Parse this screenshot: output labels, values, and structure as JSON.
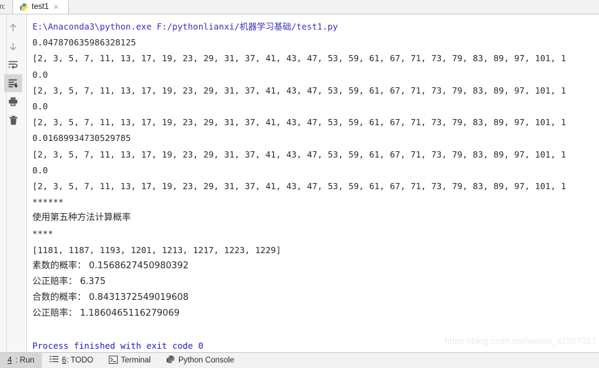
{
  "toolwindow": {
    "clipped_label": "n:"
  },
  "tabbar": {
    "tab_title": "test1",
    "tab_icon": "python-file-icon",
    "close_label": "×"
  },
  "gutter": {
    "buttons": [
      {
        "name": "up-arrow-icon",
        "title": "Up the Stack Trace",
        "active": false
      },
      {
        "name": "down-arrow-icon",
        "title": "Down the Stack Trace",
        "active": false
      },
      {
        "name": "soft-wrap-icon",
        "title": "Soft-Wrap",
        "active": false
      },
      {
        "name": "scroll-to-end-icon",
        "title": "Scroll to End",
        "active": true
      },
      {
        "name": "print-icon",
        "title": "Print",
        "active": false
      },
      {
        "name": "trash-icon",
        "title": "Clear All",
        "active": false
      }
    ]
  },
  "console": {
    "command": "E:\\Anaconda3\\python.exe F:/pythonlianxi/机器学习基础/test1.py",
    "prime_list": "[2, 3, 5, 7, 11, 13, 17, 19, 23, 29, 31, 37, 41, 43, 47, 53, 59, 61, 67, 71, 73, 79, 83, 89, 97, 101, 1",
    "lines": [
      {
        "type": "cmd",
        "text": "E:\\Anaconda3\\python.exe F:/pythonlianxi/机器学习基础/test1.py"
      },
      {
        "type": "out",
        "text": "0.047870635986328125"
      },
      {
        "type": "out",
        "text": "[2, 3, 5, 7, 11, 13, 17, 19, 23, 29, 31, 37, 41, 43, 47, 53, 59, 61, 67, 71, 73, 79, 83, 89, 97, 101, 1"
      },
      {
        "type": "out",
        "text": "0.0"
      },
      {
        "type": "out",
        "text": "[2, 3, 5, 7, 11, 13, 17, 19, 23, 29, 31, 37, 41, 43, 47, 53, 59, 61, 67, 71, 73, 79, 83, 89, 97, 101, 1"
      },
      {
        "type": "out",
        "text": "0.0"
      },
      {
        "type": "out",
        "text": "[2, 3, 5, 7, 11, 13, 17, 19, 23, 29, 31, 37, 41, 43, 47, 53, 59, 61, 67, 71, 73, 79, 83, 89, 97, 101, 1"
      },
      {
        "type": "out",
        "text": "0.01689934730529785"
      },
      {
        "type": "out",
        "text": "[2, 3, 5, 7, 11, 13, 17, 19, 23, 29, 31, 37, 41, 43, 47, 53, 59, 61, 67, 71, 73, 79, 83, 89, 97, 101, 1"
      },
      {
        "type": "out",
        "text": "0.0"
      },
      {
        "type": "out",
        "text": "[2, 3, 5, 7, 11, 13, 17, 19, 23, 29, 31, 37, 41, 43, 47, 53, 59, 61, 67, 71, 73, 79, 83, 89, 97, 101, 1"
      },
      {
        "type": "stars",
        "text": "******"
      },
      {
        "type": "cn",
        "text": "使用第五种方法计算概率"
      },
      {
        "type": "stars",
        "text": "****"
      },
      {
        "type": "out",
        "text": "[1181, 1187, 1193, 1201, 1213, 1217, 1223, 1229]"
      },
      {
        "type": "cn",
        "text": "素数的概率： 0.1568627450980392"
      },
      {
        "type": "cn",
        "text": "公正赔率： 6.375"
      },
      {
        "type": "cn",
        "text": "合数的概率： 0.8431372549019608"
      },
      {
        "type": "cn",
        "text": "公正赔率： 1.1860465116279069"
      },
      {
        "type": "blank",
        "text": ""
      },
      {
        "type": "fin",
        "text": "Process finished with exit code 0"
      }
    ],
    "results": {
      "filtered_primes": [
        1181,
        1187,
        1193,
        1201,
        1213,
        1217,
        1223,
        1229
      ],
      "prime_probability_label": "素数的概率：",
      "prime_probability": "0.1568627450980392",
      "prime_fair_odds_label": "公正赔率：",
      "prime_fair_odds": "6.375",
      "composite_probability_label": "合数的概率：",
      "composite_probability": "0.8431372549019608",
      "composite_fair_odds_label": "公正赔率：",
      "composite_fair_odds": "1.1860465116279069"
    },
    "timings": [
      "0.047870635986328125",
      "0.0",
      "0.0",
      "0.01689934730529785",
      "0.0"
    ],
    "exit_message": "Process finished with exit code 0",
    "watermark": "https://blog.csdn.net/weixin_42567027"
  },
  "statusbar": {
    "items": [
      {
        "mnemonic": "4",
        "label": ": Run",
        "icon": null,
        "active": true
      },
      {
        "mnemonic": "6",
        "label": ": TODO",
        "icon": "todo-list-icon",
        "active": false
      },
      {
        "mnemonic": "",
        "label": "Terminal",
        "icon": "terminal-icon",
        "active": false
      },
      {
        "mnemonic": "",
        "label": "Python Console",
        "icon": "python-console-icon",
        "active": false
      }
    ]
  },
  "colors": {
    "command_text": "#3b32b5",
    "output_text": "#2b2b2b",
    "finished_text": "#2020c0",
    "tab_active_bg": "#ffffff",
    "chrome_bg": "#f2f2f2",
    "active_button_bg": "#d6d6d6"
  }
}
